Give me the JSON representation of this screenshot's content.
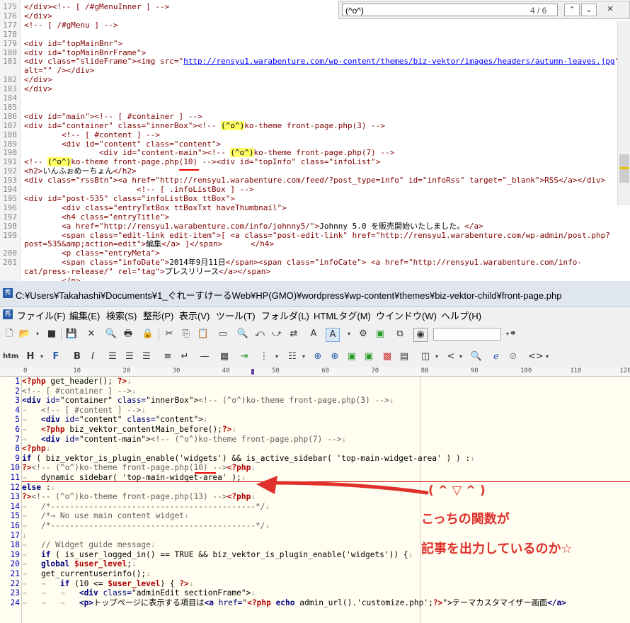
{
  "find_bar": {
    "query": "(^o^)",
    "count": "4 / 6"
  },
  "source_lines": [
    {
      "n": "175",
      "segs": [
        [
          "t",
          "</div><!-- [ /#gMenuInner ] -->"
        ]
      ]
    },
    {
      "n": "176",
      "segs": [
        [
          "t",
          "</div>"
        ]
      ]
    },
    {
      "n": "177",
      "segs": [
        [
          "t",
          "<!-- [ /#gMenu ] -->"
        ]
      ]
    },
    {
      "n": "178",
      "segs": []
    },
    {
      "n": "179",
      "segs": [
        [
          "t",
          "<div id=\"topMainBnr\">"
        ]
      ]
    },
    {
      "n": "180",
      "segs": [
        [
          "t",
          "<div id=\"topMainBnrFrame\">"
        ]
      ]
    },
    {
      "n": "181",
      "segs": [
        [
          "t",
          "<div class=\"slideFrame\"><img src=\""
        ],
        [
          "l",
          "http://rensyu1.warabenture.com/wp-content/themes/biz-vektor/images/headers/autumn-leaves.jpg"
        ],
        [
          "t",
          "\""
        ]
      ]
    },
    {
      "n": "",
      "segs": [
        [
          "t",
          "alt=\"\" /></div>"
        ]
      ]
    },
    {
      "n": "182",
      "segs": [
        [
          "t",
          "</div>"
        ]
      ]
    },
    {
      "n": "183",
      "segs": [
        [
          "t",
          "</div>"
        ]
      ]
    },
    {
      "n": "184",
      "segs": []
    },
    {
      "n": "185",
      "segs": []
    },
    {
      "n": "186",
      "segs": [
        [
          "t",
          "<div id=\"main\"><!-- [ #container ] -->"
        ]
      ]
    },
    {
      "n": "187",
      "segs": [
        [
          "t",
          "<div id=\"container\" class=\"innerBox\"><!-- "
        ],
        [
          "h",
          "(^o^)"
        ],
        [
          "t",
          "ko-theme front-page.php(3) -->"
        ]
      ]
    },
    {
      "n": "188",
      "segs": [
        [
          "t",
          "        <!-- [ #content ] -->"
        ]
      ]
    },
    {
      "n": "189",
      "segs": [
        [
          "t",
          "        <div id=\"content\" class=\"content\">"
        ]
      ]
    },
    {
      "n": "190",
      "segs": [
        [
          "t",
          "                <div id=\"content-main\"><!-- "
        ],
        [
          "h",
          "(^o^)"
        ],
        [
          "t",
          "ko-theme front-page.php(7) -->"
        ]
      ]
    },
    {
      "n": "191",
      "segs": [
        [
          "t",
          "<!-- "
        ],
        [
          "h",
          "(^o^)"
        ],
        [
          "t",
          "ko-theme front-page.php(10) --><div id=\"topInfo\" class=\"infoList\">"
        ]
      ]
    },
    {
      "n": "192",
      "segs": [
        [
          "t",
          "<h2>"
        ],
        [
          "x",
          "いんふぉめーちょん"
        ],
        [
          "t",
          "</h2>"
        ]
      ]
    },
    {
      "n": "193",
      "segs": [
        [
          "t",
          "<div class=\"rssBtn\"><a href=\"http://rensyu1.warabenture.com/feed/?post_type=info\" id=\"infoRss\" target=\"_blank\">RSS</a></div>"
        ]
      ]
    },
    {
      "n": "194",
      "segs": [
        [
          "t",
          "                        <!-- [ .infoListBox ] -->"
        ]
      ]
    },
    {
      "n": "195",
      "segs": [
        [
          "t",
          "<div id=\"post-535\" class=\"infoListBox ttBox\">"
        ]
      ]
    },
    {
      "n": "196",
      "segs": [
        [
          "t",
          "        <div class=\"entryTxtBox ttBoxTxt haveThumbnail\">"
        ]
      ]
    },
    {
      "n": "197",
      "segs": [
        [
          "t",
          "        <h4 class=\"entryTitle\">"
        ]
      ]
    },
    {
      "n": "198",
      "segs": [
        [
          "t",
          "        <a href=\"http://rensyu1.warabenture.com/info/johnny5/\">"
        ],
        [
          "x",
          "Johnny 5.0 を販売開始いたしました。"
        ],
        [
          "t",
          "</a>"
        ]
      ]
    },
    {
      "n": "199",
      "segs": [
        [
          "t",
          "        <span class=\"edit-link edit-item\">[ <a class=\"post-edit-link\" href=\"http://rensyu1.warabenture.com/wp-admin/post.php?"
        ]
      ]
    },
    {
      "n": "",
      "segs": [
        [
          "t",
          "post=535&amp;action=edit\">"
        ],
        [
          "x",
          "編集"
        ],
        [
          "t",
          "</a> ]</span>      </h4>"
        ]
      ]
    },
    {
      "n": "200",
      "segs": [
        [
          "t",
          "        <p class=\"entryMeta\">"
        ]
      ]
    },
    {
      "n": "201",
      "segs": [
        [
          "t",
          "        <span class=\"infoDate\">"
        ],
        [
          "x",
          "2014年9月11日"
        ],
        [
          "t",
          "</span><span class=\"infoCate\"> <a href=\"http://rensyu1.warabenture.com/info-"
        ]
      ]
    },
    {
      "n": "",
      "segs": [
        [
          "t",
          "cat/press-release/\" rel=\"tag\">"
        ],
        [
          "x",
          "プレスリリース"
        ],
        [
          "t",
          "</a></span>"
        ]
      ]
    },
    {
      "n": "",
      "segs": [
        [
          "t",
          "        </p>"
        ]
      ]
    }
  ],
  "window": {
    "title": "C:¥Users¥Takahashi¥Documents¥1_ぐれーすけーるWeb¥HP(GMO)¥wordpress¥wp-content¥themes¥biz-vektor-child¥front-page.php",
    "app_icon": "editor-icon"
  },
  "menu": [
    "ファイル(F)",
    "編集(E)",
    "検索(S)",
    "整形(P)",
    "表示(V)",
    "ツール(T)",
    "フォルダ(L)",
    "HTMLタグ(M)",
    "ウインドウ(W)",
    "ヘルプ(H)"
  ],
  "toolbar2_labels": {
    "htm": "htm",
    "heading": "H",
    "font": "F",
    "bold": "B",
    "italic": "I"
  },
  "ruler": [
    "0",
    "10",
    "20",
    "30",
    "40",
    "50",
    "60",
    "70",
    "80",
    "90",
    "100",
    "110",
    "120"
  ],
  "code_lines": [
    {
      "n": "1",
      "segs": [
        [
          "php",
          "<?php"
        ],
        [
          "t",
          " get_header(); "
        ],
        [
          "php",
          "?>"
        ],
        [
          "s",
          "↓"
        ]
      ]
    },
    {
      "n": "2",
      "segs": [
        [
          "cm",
          "<!-- [ #container ] -->"
        ],
        [
          "s",
          "↓"
        ]
      ]
    },
    {
      "n": "3",
      "segs": [
        [
          "tag",
          "<div"
        ],
        [
          "t",
          " "
        ],
        [
          "at",
          "id="
        ],
        [
          "t",
          "\"container\" "
        ],
        [
          "at",
          "class="
        ],
        [
          "t",
          "\"innerBox\">"
        ],
        [
          "cm",
          "<!-- (^o^)ko-theme front-page.php(3) -->"
        ],
        [
          "s",
          "↓"
        ]
      ]
    },
    {
      "n": "4",
      "segs": [
        [
          "s",
          "→   "
        ],
        [
          "cm",
          "<!-- [ #content ] -->"
        ],
        [
          "s",
          "↓"
        ]
      ]
    },
    {
      "n": "5",
      "segs": [
        [
          "s",
          "→   "
        ],
        [
          "tag",
          "<div"
        ],
        [
          "t",
          " "
        ],
        [
          "at",
          "id="
        ],
        [
          "t",
          "\"content\" "
        ],
        [
          "at",
          "class="
        ],
        [
          "t",
          "\"content\">"
        ],
        [
          "s",
          "↓"
        ]
      ]
    },
    {
      "n": "6",
      "segs": [
        [
          "s",
          "→   "
        ],
        [
          "php",
          "<?php"
        ],
        [
          "t",
          " biz_vektor_contentMain_before();"
        ],
        [
          "php",
          "?>"
        ],
        [
          "s",
          "↓"
        ]
      ]
    },
    {
      "n": "7",
      "segs": [
        [
          "s",
          "→   "
        ],
        [
          "tag",
          "<div"
        ],
        [
          "t",
          " "
        ],
        [
          "at",
          "id="
        ],
        [
          "t",
          "\"content-main\">"
        ],
        [
          "cm",
          "<!-- (^o^)ko-theme front-page.php(7) -->"
        ],
        [
          "s",
          "↓"
        ]
      ]
    },
    {
      "n": "8",
      "segs": [
        [
          "php",
          "<?php"
        ],
        [
          "s",
          "↓"
        ]
      ]
    },
    {
      "n": "9",
      "segs": [
        [
          "kw",
          "if"
        ],
        [
          "t",
          " ( biz_vektor_is_plugin_enable('widgets') && is_active_sidebar( 'top-main-widget-area' ) ) :"
        ],
        [
          "s",
          "↓"
        ]
      ]
    },
    {
      "n": "10",
      "segs": [
        [
          "php",
          "?>"
        ],
        [
          "cm",
          "<!-- (^o^)ko-theme front-page.php(10) -->"
        ],
        [
          "php",
          "<?php"
        ],
        [
          "s",
          "↓"
        ]
      ]
    },
    {
      "n": "11",
      "segs": [
        [
          "s",
          "→   "
        ],
        [
          "t",
          "dynamic_sidebar( 'top-main-widget-area' );"
        ],
        [
          "s",
          "↓"
        ]
      ]
    },
    {
      "n": "12",
      "segs": [
        [
          "kw",
          "else"
        ],
        [
          "t",
          " :"
        ],
        [
          "s",
          "↓"
        ]
      ]
    },
    {
      "n": "13",
      "segs": [
        [
          "php",
          "?>"
        ],
        [
          "cm",
          "<!-- (^o^)ko-theme front-page.php(13) -->"
        ],
        [
          "php",
          "<?php"
        ],
        [
          "s",
          "↓"
        ]
      ]
    },
    {
      "n": "14",
      "segs": [
        [
          "s",
          "→   "
        ],
        [
          "cm",
          "/*-------------------------------------------*/"
        ],
        [
          "s",
          "↓"
        ]
      ]
    },
    {
      "n": "15",
      "segs": [
        [
          "s",
          "→   "
        ],
        [
          "cm",
          "/*→ No use main content widget"
        ],
        [
          "s",
          "↓"
        ]
      ]
    },
    {
      "n": "16",
      "segs": [
        [
          "s",
          "→   "
        ],
        [
          "cm",
          "/*-------------------------------------------*/"
        ],
        [
          "s",
          "↓"
        ]
      ]
    },
    {
      "n": "17",
      "segs": [
        [
          "s",
          "↓"
        ]
      ]
    },
    {
      "n": "18",
      "segs": [
        [
          "s",
          "→   "
        ],
        [
          "cm",
          "// Widget guide message"
        ],
        [
          "s",
          "↓"
        ]
      ]
    },
    {
      "n": "19",
      "segs": [
        [
          "s",
          "→   "
        ],
        [
          "kw",
          "if"
        ],
        [
          "t",
          " ( is_user_logged_in() == TRUE && biz_vektor_is_plugin_enable('widgets')) {"
        ],
        [
          "s",
          "↓"
        ]
      ]
    },
    {
      "n": "20",
      "segs": [
        [
          "s",
          "→   "
        ],
        [
          "kw",
          "global"
        ],
        [
          "t",
          " "
        ],
        [
          "var",
          "$user_level"
        ],
        [
          "t",
          ";"
        ],
        [
          "s",
          "↓"
        ]
      ]
    },
    {
      "n": "21",
      "segs": [
        [
          "s",
          "→   "
        ],
        [
          "t",
          "get_currentuserinfo();"
        ],
        [
          "s",
          "↓"
        ]
      ]
    },
    {
      "n": "22",
      "segs": [
        [
          "s",
          "→   →   "
        ],
        [
          "kw",
          "if"
        ],
        [
          "t",
          " (10 <= "
        ],
        [
          "var",
          "$user_level"
        ],
        [
          "t",
          ") { "
        ],
        [
          "php",
          "?>"
        ],
        [
          "s",
          "↓"
        ]
      ]
    },
    {
      "n": "23",
      "segs": [
        [
          "s",
          "→   →   →   "
        ],
        [
          "tag",
          "<div"
        ],
        [
          "t",
          " "
        ],
        [
          "at",
          "class="
        ],
        [
          "t",
          "\"adminEdit sectionFrame\">"
        ],
        [
          "s",
          "↓"
        ]
      ]
    },
    {
      "n": "24",
      "segs": [
        [
          "s",
          "→   →   →   "
        ],
        [
          "tag",
          "<p>"
        ],
        [
          "t",
          "トップページに表示する項目は"
        ],
        [
          "tag",
          "<a"
        ],
        [
          "t",
          " "
        ],
        [
          "at",
          "href="
        ],
        [
          "t",
          "\""
        ],
        [
          "php",
          "<?php"
        ],
        [
          "t",
          " "
        ],
        [
          "kw",
          "echo"
        ],
        [
          "t",
          " admin_url().'customize.php';"
        ],
        [
          "php",
          "?>"
        ],
        [
          "t",
          "\">テーマカスタマイザー画面"
        ],
        [
          "tag",
          "</a>"
        ]
      ]
    }
  ],
  "annotation": {
    "face": "( ^ ▽ ^ )",
    "line1": "こっちの関数が",
    "line2": "記事を出力しているのか☆",
    "color": "#e0302c"
  }
}
